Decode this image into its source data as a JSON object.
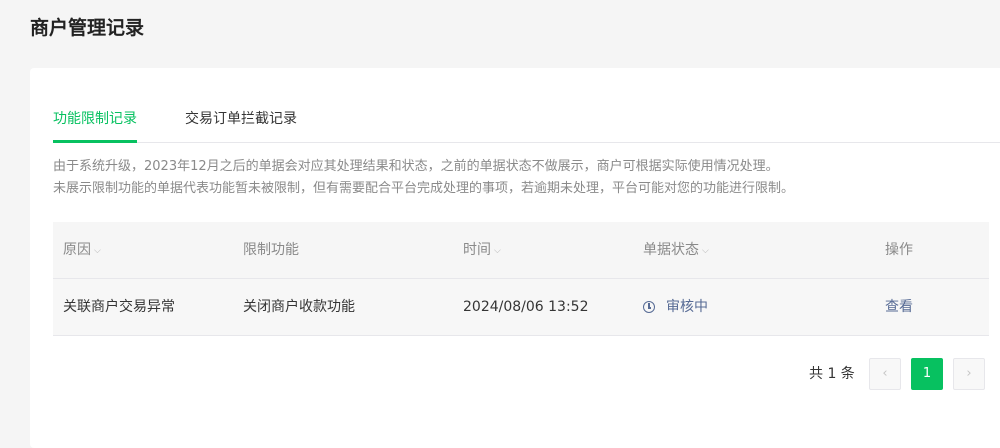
{
  "page": {
    "title": "商户管理记录"
  },
  "tabs": [
    {
      "label": "功能限制记录",
      "active": true
    },
    {
      "label": "交易订单拦截记录",
      "active": false
    }
  ],
  "notice": {
    "line1": "由于系统升级，2023年12月之后的单据会对应其处理结果和状态，之前的单据状态不做展示，商户可根据实际使用情况处理。",
    "line2": "未展示限制功能的单据代表功能暂未被限制，但有需要配合平台完成处理的事项，若逾期未处理，平台可能对您的功能进行限制。"
  },
  "table": {
    "headers": [
      "原因",
      "限制功能",
      "时间",
      "单据状态",
      "操作"
    ],
    "rows": [
      {
        "reason": "关联商户交易异常",
        "function": "关闭商户收款功能",
        "time": "2024/08/06 13:52",
        "status": "审核中",
        "action": "查看"
      }
    ]
  },
  "pagination": {
    "total_text": "共 1 条",
    "current_page": "1",
    "prev_icon": "chevron-left-icon",
    "next_icon": "chevron-right-icon"
  },
  "colors": {
    "accent": "#07c160",
    "link": "#576b95"
  }
}
